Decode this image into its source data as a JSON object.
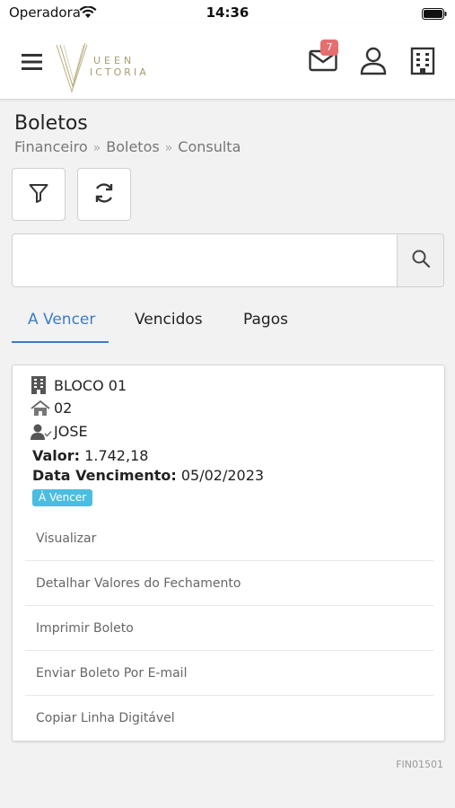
{
  "status_bar": {
    "carrier": "Operadora",
    "time": "14:36"
  },
  "header": {
    "logo": {
      "line1": "UEEN",
      "line2": "ICTORIA",
      "lettering": "QUEEN VICTORIA"
    },
    "notifications_count": "7",
    "icons": [
      "menu-icon",
      "mail-icon",
      "user-icon",
      "building-icon"
    ]
  },
  "page": {
    "title": "Boletos",
    "breadcrumb": [
      "Financeiro",
      "Boletos",
      "Consulta"
    ]
  },
  "search": {
    "value": "",
    "placeholder": ""
  },
  "tabs": [
    {
      "label": "A Vencer",
      "active": true
    },
    {
      "label": "Vencidos",
      "active": false
    },
    {
      "label": "Pagos",
      "active": false
    }
  ],
  "card": {
    "bloco": "BLOCO 01",
    "unit": "02",
    "name": "JOSE",
    "valor_label": "Valor:",
    "valor": "1.742,18",
    "vencimento_label": "Data Vencimento:",
    "vencimento": "05/02/2023",
    "status": "À Vencer",
    "actions": [
      "Visualizar",
      "Detalhar Valores do Fechamento",
      "Imprimir Boleto",
      "Enviar Boleto Por E-mail",
      "Copiar Linha Digitável"
    ]
  },
  "screen_code": "FIN01501",
  "colors": {
    "accent": "#3d7cc9",
    "badge": "#4bbde0",
    "notification": "#e56e6e",
    "logo_gold": "#a89a6e"
  }
}
